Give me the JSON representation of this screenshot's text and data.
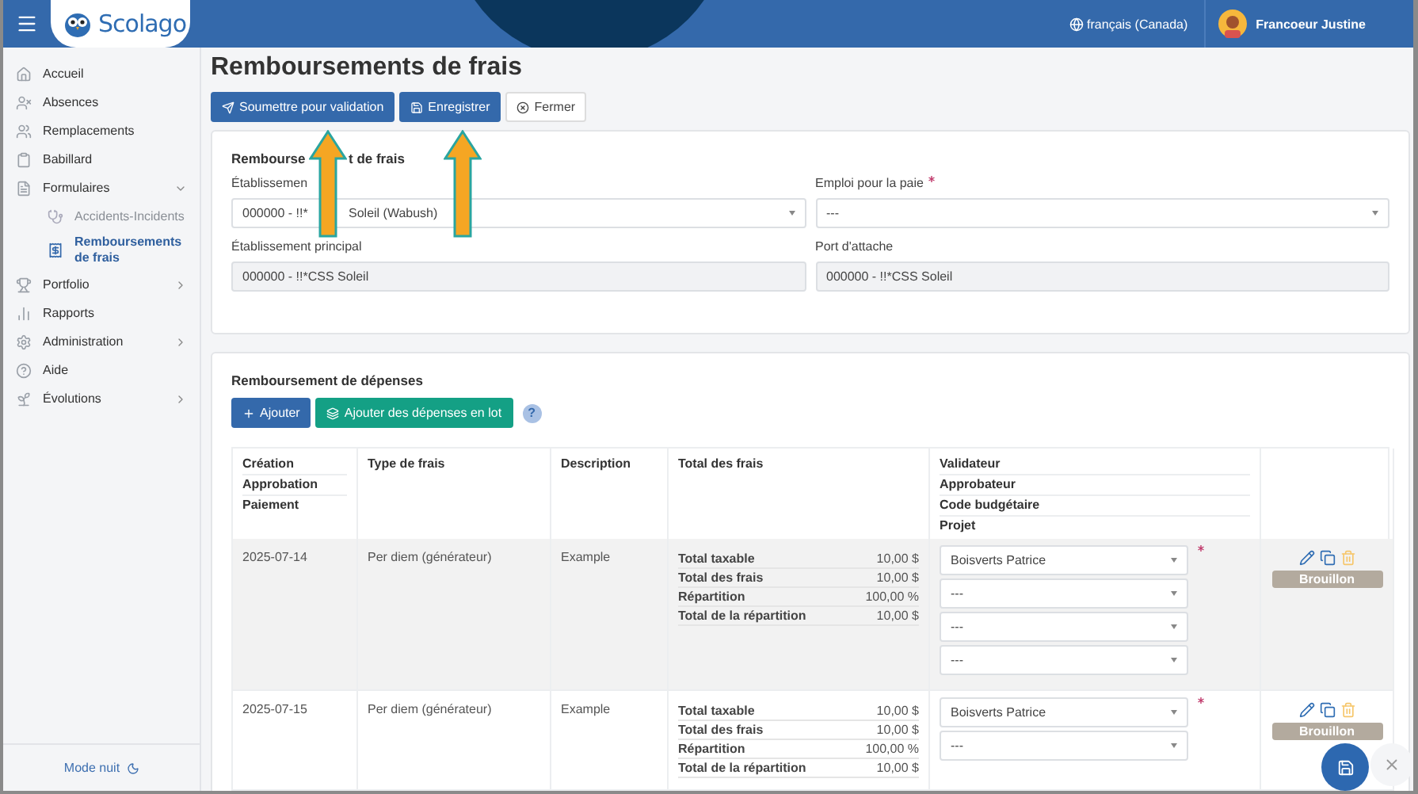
{
  "header": {
    "brand": "Scolago",
    "language": "français (Canada)",
    "user": "Francoeur Justine"
  },
  "sidebar": {
    "items": [
      {
        "label": "Accueil",
        "selected": false
      },
      {
        "label": "Absences",
        "selected": false
      },
      {
        "label": "Remplacements",
        "selected": false
      },
      {
        "label": "Babillard",
        "selected": false
      },
      {
        "label": "Formulaires",
        "selected": false,
        "expanded": true,
        "children": [
          {
            "label": "Accidents-Incidents",
            "selected": false
          },
          {
            "label": "Remboursements de frais",
            "selected": true
          }
        ]
      },
      {
        "label": "Portfolio",
        "selected": false,
        "expanded": false
      },
      {
        "label": "Rapports",
        "selected": false
      },
      {
        "label": "Administration",
        "selected": false,
        "expanded": false
      },
      {
        "label": "Aide",
        "selected": false
      },
      {
        "label": "Évolutions",
        "selected": false,
        "expanded": false
      }
    ],
    "footer": "Mode nuit"
  },
  "page": {
    "title": "Remboursements de frais"
  },
  "toolbar": [
    {
      "label": "Soumettre pour validation",
      "kind": "primary"
    },
    {
      "label": "Enregistrer",
      "kind": "primary"
    },
    {
      "label": "Fermer",
      "kind": "plain"
    }
  ],
  "form": {
    "title": [
      "Rembourse",
      "t de frais"
    ],
    "fields": [
      {
        "label": [
          "Établissemen"
        ],
        "kind": "select",
        "value": [
          "000000 - !!*",
          "Soleil (Wabush)"
        ],
        "required": false
      },
      {
        "label": [
          "Emploi pour la paie"
        ],
        "kind": "select",
        "value": [
          "---"
        ],
        "required": true
      },
      {
        "label": [
          "Établissement principal"
        ],
        "kind": "readonly",
        "value": [
          "000000 - !!*CSS Soleil"
        ],
        "required": false
      },
      {
        "label": [
          "Port d'attache"
        ],
        "kind": "readonly",
        "value": [
          "000000 - !!*CSS Soleil"
        ],
        "required": false
      }
    ]
  },
  "expenses": {
    "title": "Remboursement de dépenses",
    "buttons": [
      {
        "label": "Ajouter",
        "kind": "primary"
      },
      {
        "label": "Ajouter des dépenses en lot",
        "kind": "success"
      }
    ],
    "help": "?",
    "columns": [
      [
        "Création",
        "Approbation",
        "Paiement"
      ],
      [
        "Type de frais"
      ],
      [
        "Description"
      ],
      [
        "Total des frais"
      ],
      [
        "Validateur",
        "Approbateur",
        "Code budgétaire",
        "Projet"
      ]
    ],
    "rows": [
      {
        "date": "2025-07-14",
        "type": "Per diem (générateur)",
        "description": "Example",
        "selected": true,
        "totals": [
          {
            "label": "Total taxable",
            "value": "10,00 $"
          },
          {
            "label": "Total des frais",
            "value": "10,00 $"
          },
          {
            "label": "Répartition",
            "value": "100,00 %"
          },
          {
            "label": "Total de la répartition",
            "value": "10,00 $"
          }
        ],
        "selects": [
          {
            "value": "Boisverts Patrice",
            "required": true
          },
          {
            "value": "---",
            "required": false
          },
          {
            "value": "---",
            "required": false
          },
          {
            "value": "---",
            "required": false
          }
        ],
        "status": "Brouillon"
      },
      {
        "date": "2025-07-15",
        "type": "Per diem (générateur)",
        "description": "Example",
        "selected": false,
        "totals": [
          {
            "label": "Total taxable",
            "value": "10,00 $"
          },
          {
            "label": "Total des frais",
            "value": "10,00 $"
          },
          {
            "label": "Répartition",
            "value": "100,00 %"
          },
          {
            "label": "Total de la répartition",
            "value": "10,00 $"
          }
        ],
        "selects": [
          {
            "value": "Boisverts Patrice",
            "required": true
          },
          {
            "value": "---",
            "required": false
          }
        ],
        "status": "Brouillon"
      }
    ]
  }
}
